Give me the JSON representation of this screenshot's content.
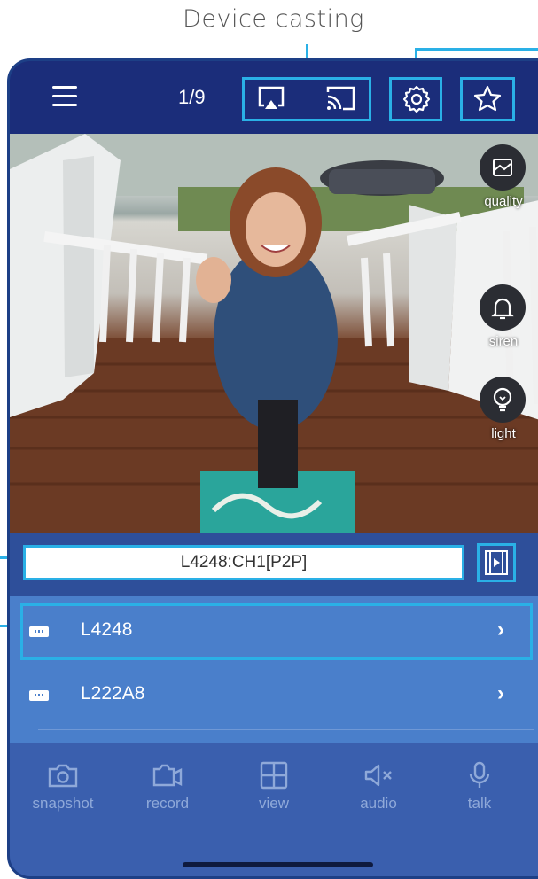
{
  "callout": {
    "title": "Device casting"
  },
  "header": {
    "page_count": "1/9",
    "icons": [
      "menu-icon",
      "airplay-icon",
      "cast-icon",
      "gear-icon",
      "star-icon"
    ]
  },
  "video_controls": {
    "quality_label": "quality",
    "siren_label": "siren",
    "light_label": "light"
  },
  "channel": {
    "name": "L4248:CH1[P2P]"
  },
  "devices": [
    {
      "label": "L4248"
    },
    {
      "label": "L222A8"
    }
  ],
  "toolbar": {
    "snapshot": "snapshot",
    "record": "record",
    "view": "view",
    "audio": "audio",
    "talk": "talk"
  },
  "colors": {
    "highlight": "#2ab0e6",
    "header": "#1b2d7a",
    "list": "#4a7fcb"
  }
}
